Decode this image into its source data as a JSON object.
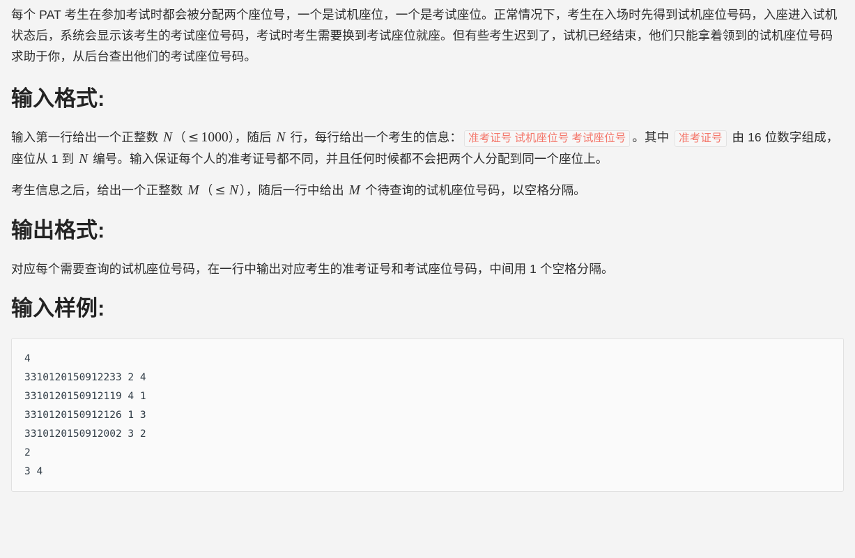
{
  "document": {
    "intro": {
      "text": "每个 PAT 考生在参加考试时都会被分配两个座位号，一个是试机座位，一个是考试座位。正常情况下，考生在入场时先得到试机座位号码，入座进入试机状态后，系统会显示该考生的考试座位号码，考试时考生需要换到考试座位就座。但有些考生迟到了，试机已经结束，他们只能拿着领到的试机座位号码求助于你，从后台查出他们的考试座位号码。"
    },
    "sections": {
      "input_format_heading": "输入格式:",
      "output_format_heading": "输出格式:",
      "input_sample_heading": "输入样例:"
    },
    "input_format": {
      "p1_a": "输入第一行给出一个正整数 ",
      "p1_N1": "N",
      "p1_b": "（",
      "p1_le": "≤",
      "p1_1000": "1000",
      "p1_c": "），随后 ",
      "p1_N2": "N",
      "p1_d": " 行，每行给出一个考生的信息：",
      "p1_code": "准考证号 试机座位号 考试座位号",
      "p1_e": "。其中 ",
      "p1_code2": "准考证号",
      "p1_f": " 由 ",
      "p1_16": "16",
      "p1_g": " 位数字组成，座位从 ",
      "p1_1": "1",
      "p1_h": " 到 ",
      "p1_N3": "N",
      "p1_i": " 编号。输入保证每个人的准考证号都不同，并且任何时候都不会把两个人分配到同一个座位上。",
      "p2_a": "考生信息之后，给出一个正整数 ",
      "p2_M1": "M",
      "p2_b": "（",
      "p2_le": "≤",
      "p2_N": "N",
      "p2_c": "），随后一行中给出 ",
      "p2_M2": "M",
      "p2_d": " 个待查询的试机座位号码，以空格分隔。"
    },
    "output_format": {
      "p1_a": "对应每个需要查询的试机座位号码，在一行中输出对应考生的准考证号和考试座位号码，中间用 ",
      "p1_1": "1",
      "p1_b": " 个空格分隔。"
    },
    "input_sample": {
      "code": "4\n3310120150912233 2 4\n3310120150912119 4 1\n3310120150912126 1 3\n3310120150912002 3 2\n2\n3 4"
    },
    "colors": {
      "page_background": "#f4f4f4",
      "body_text": "#2e2e2e",
      "heading_text": "#232323",
      "inline_code_text": "#f4786c",
      "inline_code_background": "#f7f7f7",
      "inline_code_border": "#e3e3e3",
      "codeblock_background": "#fafafa",
      "codeblock_border": "#e1e1e1",
      "codeblock_text": "#2f3b45"
    }
  }
}
